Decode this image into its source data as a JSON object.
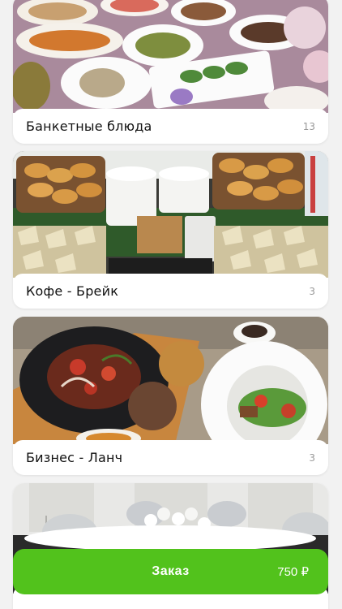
{
  "categories": [
    {
      "title": "Банкетные блюда",
      "count": "13"
    },
    {
      "title": "Кофе - Брейк",
      "count": "3"
    },
    {
      "title": "Бизнес - Ланч",
      "count": "3"
    },
    {
      "title": "",
      "count": ""
    }
  ],
  "order_button": {
    "label": "Заказ",
    "price": "750 ₽"
  },
  "colors": {
    "accent": "#52c21c",
    "card": "#ffffff",
    "background": "#f2f2f2",
    "count_text": "#9a9a9a"
  }
}
